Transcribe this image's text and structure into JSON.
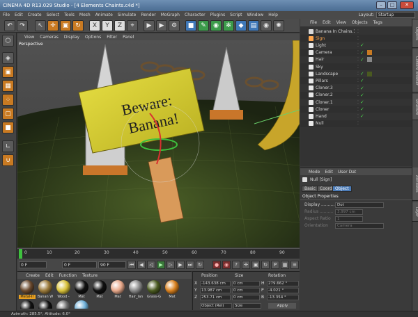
{
  "app": {
    "title": "CINEMA 4D R13.029 Studio - [4 Elements Chaints.c4d *]"
  },
  "menu": {
    "items": [
      "File",
      "Edit",
      "Create",
      "Select",
      "Tools",
      "Mesh",
      "Animate",
      "Simulate",
      "Render",
      "MoGraph",
      "Character",
      "Plugins",
      "Script",
      "Window",
      "Help"
    ],
    "layout_label": "Layout:",
    "layout_value": "Startup"
  },
  "viewport": {
    "menu": [
      "View",
      "Cameras",
      "Display",
      "Options",
      "Filter",
      "Panel"
    ],
    "label": "Perspective",
    "sign_text_line1": "Beware:",
    "sign_text_line2": "Banana!"
  },
  "timeline": {
    "ticks": [
      "0",
      "10",
      "20",
      "30",
      "40",
      "50",
      "60",
      "70",
      "80",
      "90"
    ],
    "frame_start": "0 F",
    "frame_end": "90 F",
    "current_frame": "0 F",
    "end_field": "90 F"
  },
  "materials": {
    "menu": [
      "Create",
      "Edit",
      "Function",
      "Texture"
    ],
    "items": [
      {
        "label": "Metal-Ir",
        "color": "#6b4a2e"
      },
      {
        "label": "Banan W",
        "color": "#9b7a3a"
      },
      {
        "label": "Wood -",
        "color": "#d9c23a"
      },
      {
        "label": "Mat",
        "color": "#111111"
      },
      {
        "label": "Mat",
        "color": "#111111"
      },
      {
        "label": "Mat",
        "color": "#e8a88a"
      },
      {
        "label": "Hair_lan",
        "color": "#8a8a8a"
      },
      {
        "label": "Grass-G",
        "color": "#4a5a20"
      },
      {
        "label": "Mat",
        "color": "#d8801e"
      }
    ],
    "row2": [
      {
        "color": "#111111"
      },
      {
        "color": "#111111"
      },
      {
        "color": "#6a6a6a"
      },
      {
        "color": "#6fb0d8"
      }
    ]
  },
  "coords": {
    "headers": [
      "Position",
      "Size",
      "Rotation"
    ],
    "rows": [
      {
        "axis": "X",
        "pos": "-143.638 cm",
        "size": "0 cm",
        "rot_axis": "H",
        "rot": "279.662 °"
      },
      {
        "axis": "Y",
        "pos": "13.987 cm",
        "size": "0 cm",
        "rot_axis": "P",
        "rot": "-4.021 °"
      },
      {
        "axis": "Z",
        "pos": "253.71 cm",
        "size": "0 cm",
        "rot_axis": "B",
        "rot": "-13.354 °"
      }
    ],
    "mode_select": "Object (Rel)",
    "size_select": "Size",
    "apply_label": "Apply"
  },
  "object_manager": {
    "menu": [
      "File",
      "Edit",
      "View",
      "Objects",
      "Tags"
    ],
    "objects": [
      {
        "name": "Banana In Chains.1",
        "color": "#d8d8d8",
        "check": false,
        "tag": ""
      },
      {
        "name": "Sign",
        "color": "#ffa64d",
        "check": false,
        "tag": ""
      },
      {
        "name": "Light",
        "color": "#e8e8e8",
        "check": true,
        "tag": ""
      },
      {
        "name": "Camera",
        "color": "#e8e8e8",
        "check": true,
        "tag": "#c97a22"
      },
      {
        "name": "Hair",
        "color": "#e8e8e8",
        "check": true,
        "tag": "#888888"
      },
      {
        "name": "Sky",
        "color": "#e8e8e8",
        "check": false,
        "tag": ""
      },
      {
        "name": "Landscape",
        "color": "#e8e8e8",
        "check": true,
        "tag": "#4a5a20"
      },
      {
        "name": "Pillars",
        "color": "#e8e8e8",
        "check": true,
        "tag": ""
      },
      {
        "name": "Cloner.3",
        "color": "#e8e8e8",
        "check": true,
        "tag": ""
      },
      {
        "name": "Cloner.2",
        "color": "#e8e8e8",
        "check": true,
        "tag": ""
      },
      {
        "name": "Cloner.1",
        "color": "#e8e8e8",
        "check": true,
        "tag": ""
      },
      {
        "name": "Cloner",
        "color": "#e8e8e8",
        "check": true,
        "tag": ""
      },
      {
        "name": "Hand",
        "color": "#e8e8e8",
        "check": true,
        "tag": ""
      },
      {
        "name": "Null",
        "color": "#e8e8e8",
        "check": false,
        "tag": ""
      }
    ]
  },
  "attributes": {
    "menu": [
      "Mode",
      "Edit",
      "User Dat"
    ],
    "object_title": "Null [Sign]",
    "tabs": [
      "Basic",
      "Coord",
      "Object"
    ],
    "section": "Object Properties",
    "rows": [
      {
        "label": "Display ..........",
        "value": "Dot",
        "dim": false
      },
      {
        "label": "Radius ..........",
        "value": "3.997 cm",
        "dim": true
      },
      {
        "label": "Aspect Ratio",
        "value": "1",
        "dim": true
      },
      {
        "label": "Orientation",
        "value": "Camera",
        "dim": true
      }
    ]
  },
  "right_tabs": [
    "Objects",
    "Content Browser",
    "Structure",
    "Attributes",
    "Layer"
  ],
  "status": {
    "text": "Azimuth: 285.5°, Altitude: 6.0°"
  }
}
